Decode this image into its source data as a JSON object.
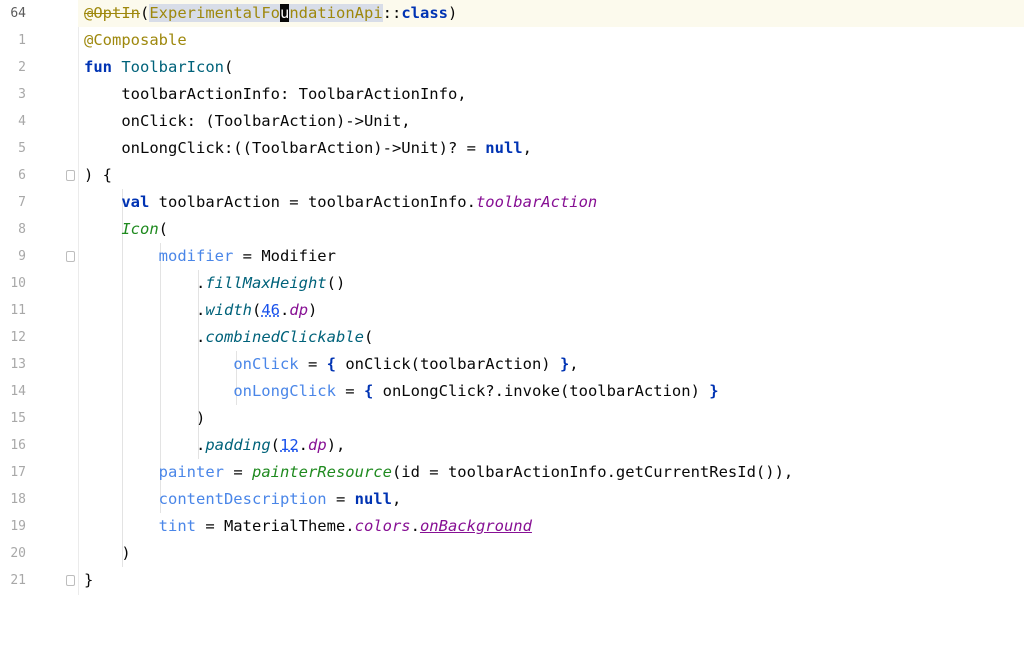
{
  "editor": {
    "gutter_numbers": [
      "64",
      "1",
      "2",
      "3",
      "4",
      "5",
      "6",
      "7",
      "8",
      "9",
      "10",
      "11",
      "12",
      "13",
      "14",
      "15",
      "16",
      "17",
      "18",
      "19",
      "20",
      "21"
    ],
    "tokens": {
      "t0_0": "@OptIn",
      "t0_1": "(",
      "t0_2": "ExperimentalFo",
      "t0_3": "u",
      "t0_4": "ndationApi",
      "t0_5": "::",
      "t0_6": "class",
      "t0_7": ")",
      "t1_0": "@Composable",
      "t2_0": "fun",
      "t2_1": " ",
      "t2_2": "ToolbarIcon",
      "t2_3": "(",
      "t3_0": "    toolbarActionInfo: ToolbarActionInfo,",
      "t4_0": "    onClick: (ToolbarAction)->Unit,",
      "t5_0": "    onLongClick:((ToolbarAction)->Unit)? = ",
      "t5_1": "null",
      "t5_2": ",",
      "t6_0": ") {",
      "t7_0": "    ",
      "t7_1": "val",
      "t7_2": " toolbarAction = toolbarActionInfo.",
      "t7_3": "toolbarAction",
      "t8_0": "    ",
      "t8_1": "Icon",
      "t8_2": "(",
      "t9_0": "        ",
      "t9_1": "modifier",
      "t9_2": " = ",
      "t9_3": "Modifier",
      "t10_0": "            .",
      "t10_1": "fillMaxHeight",
      "t10_2": "()",
      "t11_0": "            .",
      "t11_1": "width",
      "t11_2": "(",
      "t11_3": "46",
      "t11_4": ".",
      "t11_5": "dp",
      "t11_6": ")",
      "t12_0": "            .",
      "t12_1": "combinedClickable",
      "t12_2": "(",
      "t13_0": "                ",
      "t13_1": "onClick",
      "t13_2": " = ",
      "t13_3": "{",
      "t13_4": " onClick(toolbarAction) ",
      "t13_5": "}",
      "t13_6": ",",
      "t14_0": "                ",
      "t14_1": "onLongClick",
      "t14_2": " = ",
      "t14_3": "{",
      "t14_4": " onLongClick?.invoke(toolbarAction) ",
      "t14_5": "}",
      "t15_0": "            )",
      "t16_0": "            .",
      "t16_1": "padding",
      "t16_2": "(",
      "t16_3": "12",
      "t16_4": ".",
      "t16_5": "dp",
      "t16_6": "),",
      "t17_0": "        ",
      "t17_1": "painter",
      "t17_2": " = ",
      "t17_3": "painterResource",
      "t17_4": "(id = toolbarActionInfo.getCurrentResId()),",
      "t18_0": "        ",
      "t18_1": "contentDescription",
      "t18_2": " = ",
      "t18_3": "null",
      "t18_4": ",",
      "t19_0": "        ",
      "t19_1": "tint",
      "t19_2": " = MaterialTheme.",
      "t19_3": "colors",
      "t19_4": ".",
      "t19_5": "onBackground",
      "t20_0": "    )",
      "t21_0": "}"
    }
  }
}
